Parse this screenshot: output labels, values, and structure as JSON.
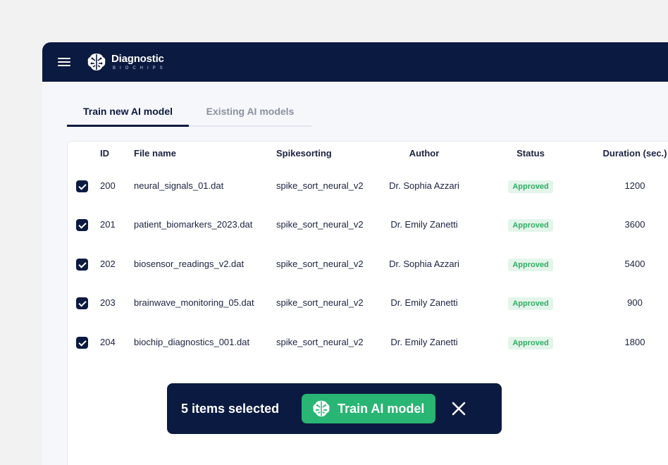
{
  "brand": {
    "title": "Diagnostic",
    "subtitle": "BIOCHIPS"
  },
  "tabs": [
    {
      "label": "Train new AI model",
      "active": true
    },
    {
      "label": "Existing AI models",
      "active": false
    }
  ],
  "table": {
    "columns": [
      "ID",
      "File name",
      "Spikesorting",
      "Author",
      "Status",
      "Duration (sec.)"
    ],
    "rows": [
      {
        "checked": true,
        "id": "200",
        "file": "neural_signals_01.dat",
        "spike": "spike_sort_neural_v2",
        "author": "Dr. Sophia Azzari",
        "status": "Approved",
        "duration": "1200"
      },
      {
        "checked": true,
        "id": "201",
        "file": "patient_biomarkers_2023.dat",
        "spike": "spike_sort_neural_v2",
        "author": "Dr. Emily Zanetti",
        "status": "Approved",
        "duration": "3600"
      },
      {
        "checked": true,
        "id": "202",
        "file": "biosensor_readings_v2.dat",
        "spike": "spike_sort_neural_v2",
        "author": "Dr. Sophia Azzari",
        "status": "Approved",
        "duration": "5400"
      },
      {
        "checked": true,
        "id": "203",
        "file": "brainwave_monitoring_05.dat",
        "spike": "spike_sort_neural_v2",
        "author": "Dr. Emily Zanetti",
        "status": "Approved",
        "duration": "900"
      },
      {
        "checked": true,
        "id": "204",
        "file": "biochip_diagnostics_001.dat",
        "spike": "spike_sort_neural_v2",
        "author": "Dr. Emily Zanetti",
        "status": "Approved",
        "duration": "1800"
      }
    ]
  },
  "selection_bar": {
    "count_text": "5 items selected",
    "train_label": "Train AI model",
    "close_icon": "close-icon"
  },
  "colors": {
    "navy": "#0b1a40",
    "green": "#29b573",
    "badge_bg": "#e3f5ea",
    "badge_text": "#2fae63"
  },
  "icons": [
    "menu-icon",
    "brain-logo-icon",
    "checkbox-checked-icon",
    "brain-icon",
    "close-icon"
  ]
}
